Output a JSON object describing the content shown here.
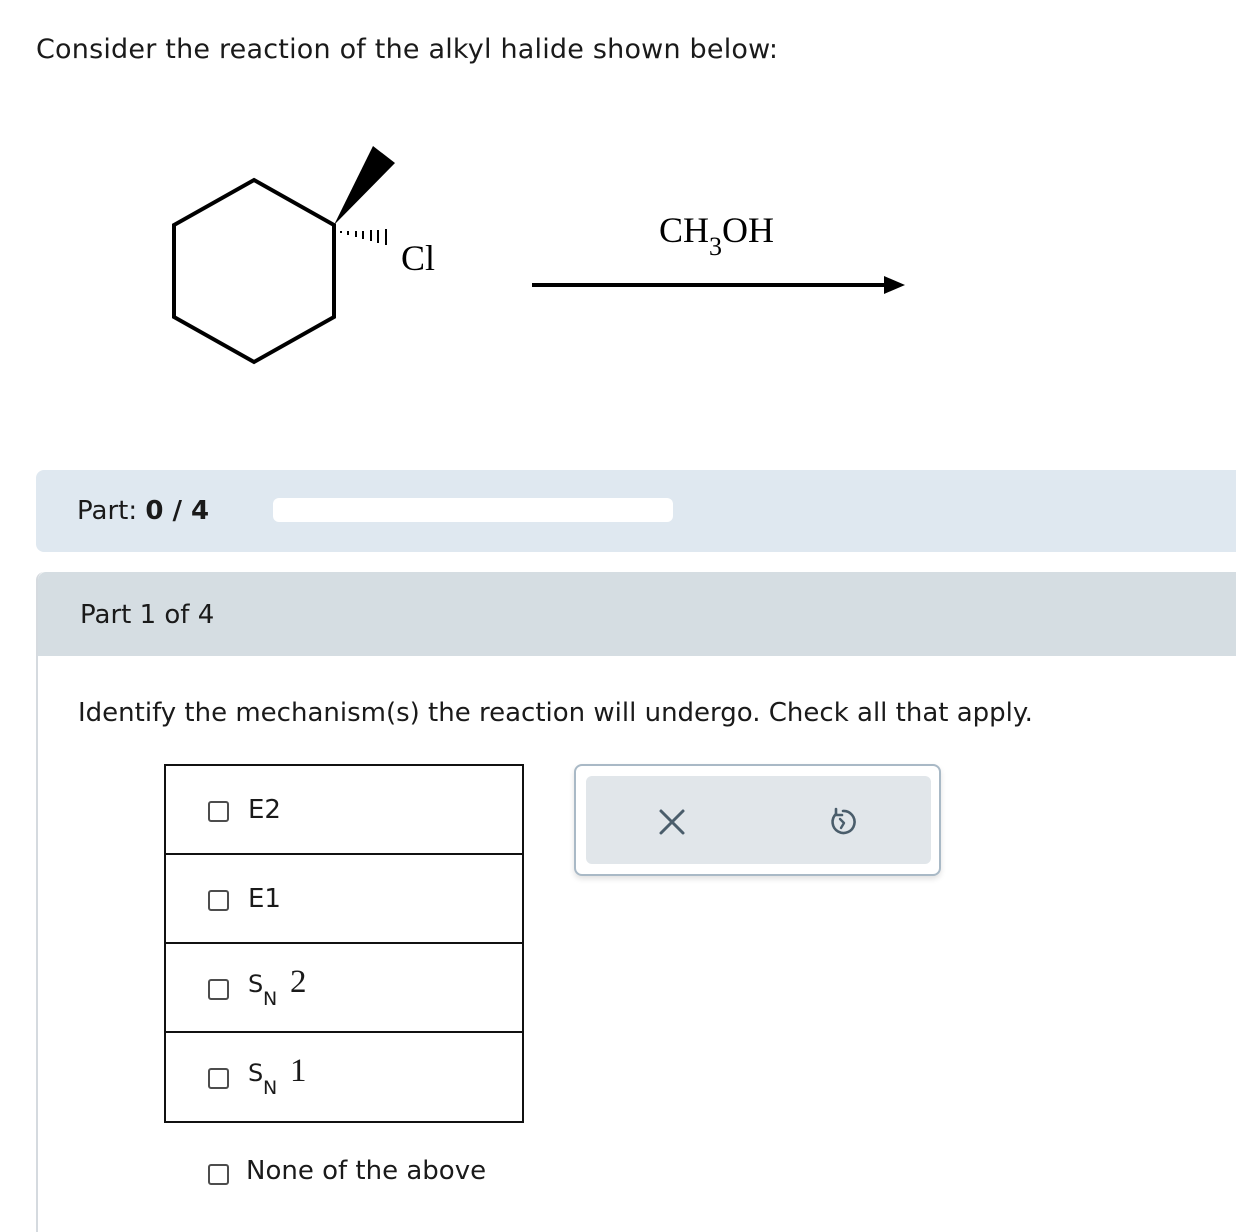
{
  "intro": {
    "text": "Consider the reaction of the alkyl halide shown below:"
  },
  "reaction": {
    "substituent_label": "Cl",
    "reagent_main_1": "CH",
    "reagent_sub": "3",
    "reagent_main_2": "OH"
  },
  "progress": {
    "label": "Part:",
    "value": "0 / 4",
    "fraction": 0.0
  },
  "part": {
    "header": "Part 1 of 4",
    "question": "Identify the mechanism(s) the reaction will undergo. Check all that apply."
  },
  "options": {
    "e2": "E2",
    "e1": "E1",
    "sn2": {
      "s": "S",
      "n": "N",
      "num": "2"
    },
    "sn1": {
      "s": "S",
      "n": "N",
      "num": "1"
    },
    "none": "None of the above"
  },
  "tools": {
    "clear_icon": "close-icon",
    "undo_icon": "undo-icon"
  },
  "colors": {
    "progress_bg": "#dfe8f0",
    "header_bg": "#d5dde2",
    "tools_bg": "#e1e6ea",
    "tool_icon": "#4a5d6b"
  }
}
